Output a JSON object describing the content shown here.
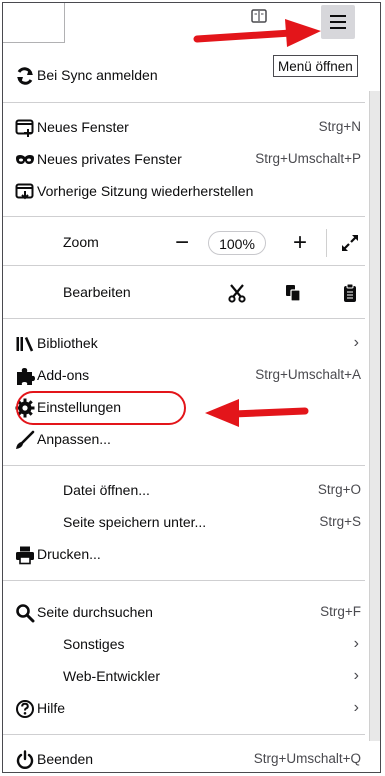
{
  "toolbar": {
    "tooltip": "Menü öffnen"
  },
  "sync": {
    "label": "Bei Sync anmelden"
  },
  "items": {
    "new_window": {
      "label": "Neues Fenster",
      "shortcut": "Strg+N"
    },
    "private_window": {
      "label": "Neues privates Fenster",
      "shortcut": "Strg+Umschalt+P"
    },
    "restore_session": {
      "label": "Vorherige Sitzung wiederherstellen"
    },
    "zoom": {
      "label": "Zoom",
      "value": "100%",
      "minus": "−",
      "plus": "+"
    },
    "edit": {
      "label": "Bearbeiten"
    },
    "library": {
      "label": "Bibliothek"
    },
    "addons": {
      "label": "Add-ons",
      "shortcut": "Strg+Umschalt+A"
    },
    "settings": {
      "label": "Einstellungen"
    },
    "customize": {
      "label": "Anpassen..."
    },
    "open_file": {
      "label": "Datei öffnen...",
      "shortcut": "Strg+O"
    },
    "save_page": {
      "label": "Seite speichern unter...",
      "shortcut": "Strg+S"
    },
    "print": {
      "label": "Drucken..."
    },
    "find": {
      "label": "Seite durchsuchen",
      "shortcut": "Strg+F"
    },
    "more": {
      "label": "Sonstiges"
    },
    "web_dev": {
      "label": "Web-Entwickler"
    },
    "help": {
      "label": "Hilfe"
    },
    "quit": {
      "label": "Beenden",
      "shortcut": "Strg+Umschalt+Q"
    }
  },
  "chevron": "›",
  "colors": {
    "annotation_red": "#e3151a",
    "hover_gray": "#d7d7db"
  }
}
